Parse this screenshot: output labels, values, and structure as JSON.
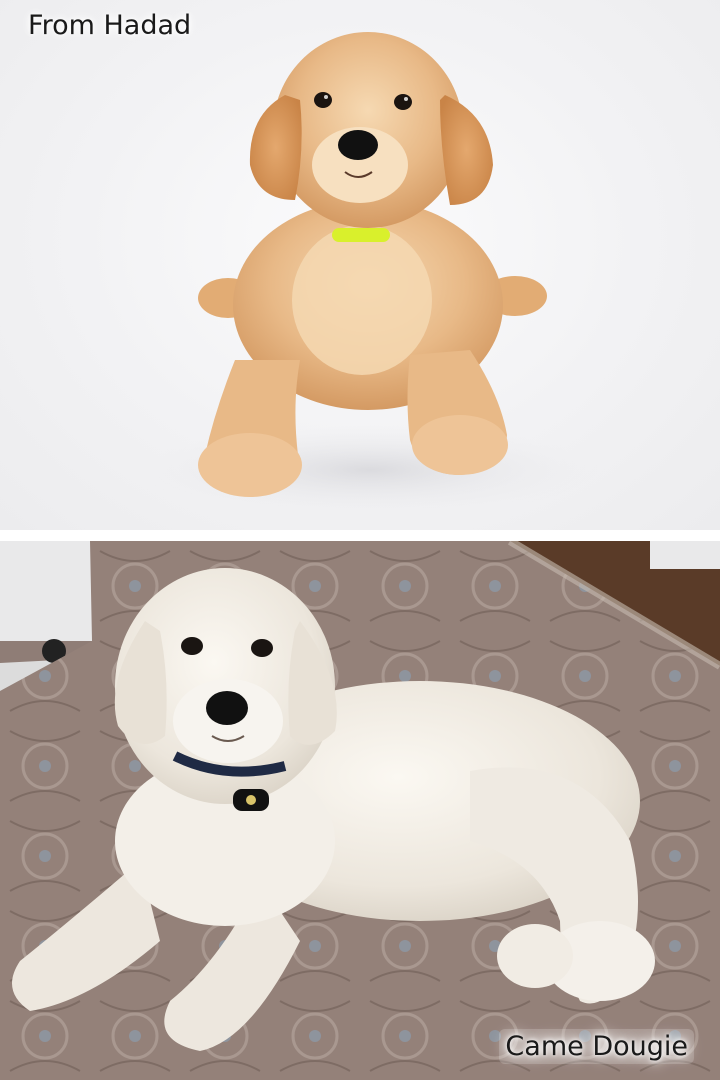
{
  "captions": {
    "top": "From Hadad",
    "bottom": "Came Dougie"
  },
  "photos": {
    "top": {
      "subject": "golden curly-coated puppy lying on white studio backdrop",
      "icon": "puppy-photo"
    },
    "bottom": {
      "subject": "white curly-coated adult dog lying on patterned rug",
      "icon": "adult-dog-photo"
    }
  },
  "colors": {
    "puppy_coat": "#e8b987",
    "adult_coat": "#f1ede6",
    "rug": "#8f7d76",
    "collar": "#d9f02c"
  }
}
